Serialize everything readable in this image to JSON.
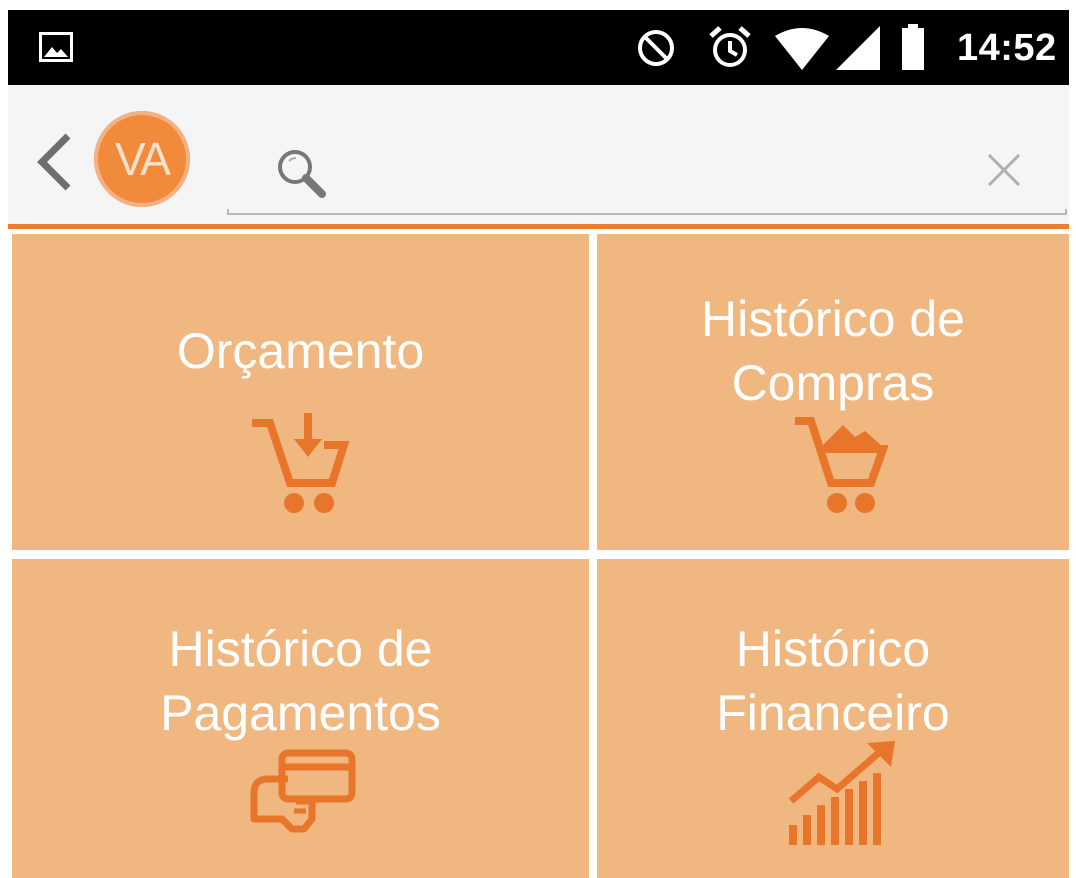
{
  "status_bar": {
    "time": "14:52",
    "icons": [
      "gallery-icon",
      "do-not-disturb-icon",
      "alarm-icon",
      "wifi-icon",
      "signal-icon",
      "battery-icon"
    ]
  },
  "toolbar": {
    "back_icon": "chevron-left-icon",
    "avatar_initials": "VA",
    "search": {
      "value": "",
      "placeholder": ""
    },
    "clear_icon": "close-icon"
  },
  "tiles": [
    {
      "lines": [
        "Orçamento"
      ],
      "icon": "cart-download-icon"
    },
    {
      "lines": [
        "Histórico de",
        "Compras"
      ],
      "icon": "full-cart-icon"
    },
    {
      "lines": [
        "Histórico de",
        "Pagamentos"
      ],
      "icon": "card-payment-icon"
    },
    {
      "lines": [
        "Histórico",
        "Financeiro"
      ],
      "icon": "growth-chart-icon"
    }
  ],
  "colors": {
    "accent": "#ec7d2c",
    "tile_bg": "#f0b781",
    "avatar_bg": "#f28a3c",
    "icon": "#e8762a",
    "toolbar_bg": "#f5f5f5",
    "status_bar_bg": "#000000"
  }
}
